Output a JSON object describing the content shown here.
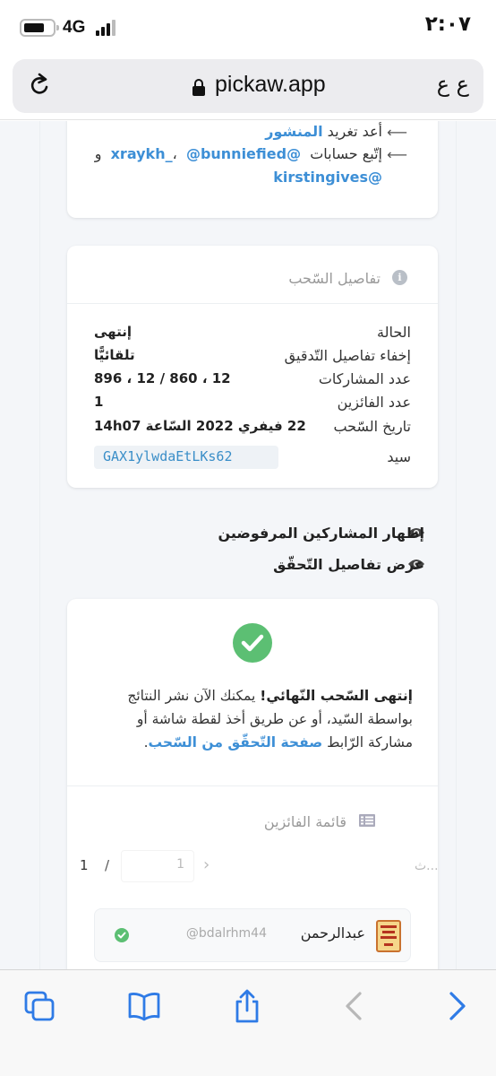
{
  "status_bar": {
    "time": "٢:٠٧",
    "network": "4G"
  },
  "browser": {
    "url": "pickaw.app",
    "text_size_label": "ع ع"
  },
  "instructions": {
    "line1_prefix": "أعد تغريد",
    "line1_link": "المنشور",
    "line2_prefix": "إتّبع حسابات",
    "handles": [
      "@bunniefied",
      "@xraykh_",
      "@kirstingives"
    ],
    "conjunction": "و",
    "comma": "،"
  },
  "draw_details": {
    "title": "تفاصيل السّحب",
    "rows": [
      {
        "label": "الحالة",
        "value": "إنتهى"
      },
      {
        "label": "إخفاء تفاصيل التّدقيق",
        "value": "تلقائيًّا"
      },
      {
        "label": "عدد المشاركات",
        "value": "12 ، 860 / 12 ، 896"
      },
      {
        "label": "عدد الفائزين",
        "value": "1"
      },
      {
        "label": "تاريخ السّحب",
        "value": "22 فيفري 2022 السّاعة 14h07"
      },
      {
        "label": "سيد",
        "value": "GAX1ylwdaEtLKs62"
      }
    ]
  },
  "toggles": {
    "show_rejected": "إظهار المشاركين المرفوضين",
    "show_verification": "عرض تفاصيل التّحقّق"
  },
  "final": {
    "bold": "إنتهى السّحب النّهائي!",
    "text1": " يمكنك الآن نشر النتائج بواسطة السّيد، أو عن طريق أخذ لقطة شاشة أو مشاركة الرّابط ",
    "link": "صفحة التّحقّق من السّحب",
    "period": "."
  },
  "winners": {
    "title": "قائمة الفائزين",
    "search_placeholder": "...ث",
    "page_current": "1",
    "page_sep": "/",
    "page_total": "1",
    "items": [
      {
        "name": "عبدالرحمن",
        "handle": "@bdalrhm44"
      }
    ]
  },
  "colors": {
    "accent": "#3d8fd6",
    "success": "#5cbf73",
    "page_bg": "#f4f6f9"
  }
}
